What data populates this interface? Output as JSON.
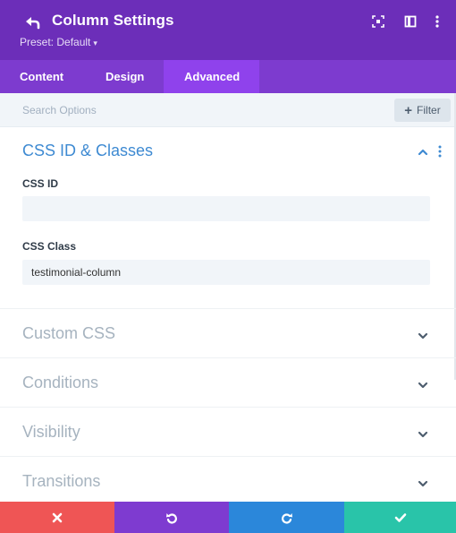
{
  "header": {
    "title": "Column Settings",
    "preset_label": "Preset: Default",
    "background": "#6c2eb9"
  },
  "tabs": [
    {
      "label": "Content",
      "active": false
    },
    {
      "label": "Design",
      "active": false
    },
    {
      "label": "Advanced",
      "active": true
    }
  ],
  "search": {
    "placeholder": "Search Options",
    "value": "",
    "filter_label": "Filter"
  },
  "sections": {
    "open": {
      "title": "CSS ID & Classes",
      "fields": [
        {
          "label": "CSS ID",
          "value": ""
        },
        {
          "label": "CSS Class",
          "value": "testimonial-column"
        }
      ]
    },
    "collapsed": [
      {
        "title": "Custom CSS"
      },
      {
        "title": "Conditions"
      },
      {
        "title": "Visibility"
      },
      {
        "title": "Transitions"
      }
    ]
  },
  "footer": {
    "colors": {
      "cancel": "#ef5555",
      "undo": "#7e3bd0",
      "redo": "#2b87da",
      "save": "#29c4a9"
    }
  }
}
